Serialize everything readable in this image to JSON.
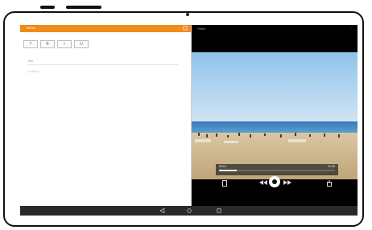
{
  "left_app": {
    "title": "Memo",
    "toolbar_buttons": [
      "T",
      "B",
      "I",
      "U"
    ],
    "title_label": "Title",
    "body_placeholder": "Content"
  },
  "right_app": {
    "title": "Video",
    "time_elapsed": "00:12",
    "time_total": "01:20",
    "progress": 0.15
  },
  "colors": {
    "accent": "#f08c1a"
  }
}
